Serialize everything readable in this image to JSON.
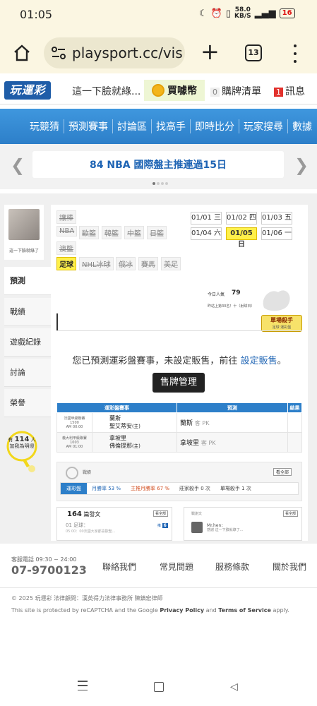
{
  "status_bar": {
    "time": "01:05",
    "net_speed": "58.0",
    "net_unit": "KB/S",
    "battery": "16"
  },
  "browser": {
    "url": "playsport.cc/vis",
    "tab_count": "13"
  },
  "site_header": {
    "logo": "玩運彩",
    "nickname": "這一下臉就綠...",
    "coin_label": "買噱幣",
    "cart_count": "0",
    "cart_label": "購牌清單",
    "msg_count": "1",
    "msg_label": "訊息"
  },
  "nav": {
    "items": [
      "玩競猜",
      "預測賽事",
      "討論區",
      "找高手",
      "即時比分",
      "玩家搜尋",
      "數據"
    ]
  },
  "banner": {
    "text": "84 NBA 國際盤主推連過15日"
  },
  "profile": {
    "nickname": "這一下臉就綠了",
    "fans_prefix": "有",
    "fans_count": "114",
    "fans_suffix": "人",
    "fans_line2": "加我為明燈"
  },
  "side_tabs": [
    "預測",
    "戰績",
    "遊戲紀錄",
    "討論",
    "榮譽"
  ],
  "categories": {
    "row1": [
      "讓棒"
    ],
    "row2": [
      "NBA",
      "歐籃",
      "韓籃",
      "中籃",
      "日籃"
    ],
    "row3": [
      "澳籃"
    ],
    "row4": [
      "足球",
      "NHL冰球",
      "俄冰",
      "賽馬",
      "美足"
    ]
  },
  "dates": [
    "01/01 三",
    "01/02 四",
    "01/03 五",
    "01/04 六",
    "01/05 日",
    "01/06 一"
  ],
  "popularity": {
    "label": "今日人氣",
    "value": "79",
    "rank": "昨站上第30名！十（射球日）"
  },
  "badge": {
    "title": "單場殺手",
    "sub": "足球 運彩盤"
  },
  "notice": {
    "text": "您已預測運彩盤賽事，未設定販售，前往",
    "link": "設定販售",
    "end": "。"
  },
  "sale_button": "售牌管理",
  "prediction_table": {
    "headers": [
      "運彩盤賽事",
      "預測",
      "結果"
    ],
    "rows": [
      {
        "league": "法國甲級聯賽",
        "code": "1500",
        "time": "AM 00:00",
        "home": "蘭斯",
        "away": "聖艾蒂安",
        "away_mark": "(主)",
        "pick": "蘭斯",
        "pick_type": "客 PK"
      },
      {
        "league": "義大利甲級聯賽",
        "code": "1003",
        "time": "AM 01:00",
        "home": "拿坡里",
        "away": "佛倫提那",
        "away_mark": "(主)",
        "pick": "拿坡里",
        "pick_type": "客 PK"
      }
    ]
  },
  "record": {
    "title": "戰績",
    "view_all": "看全部",
    "tab": "運彩盤",
    "month_win": "月勝率 53 %",
    "main_win": "主推月勝率 67 %",
    "season_kill": "莊家殺手 0 次",
    "single_kill": "單場殺手 1 次"
  },
  "articles": {
    "count": "164",
    "label": "篇發文",
    "view_all": "看全部",
    "line1": "01 足球：",
    "line2": "05  00：00法國大家都喜歡聖...",
    "tag": "推",
    "tag_num": "6"
  },
  "messages": {
    "title": "戰謝文",
    "view_all": "看全部",
    "name": "Mr.hen：",
    "text": "感謝 這一下臉就綠了..."
  },
  "footer": {
    "tel_label": "客服電話 09:30 ~ 24:00",
    "tel": "07-9700123",
    "links": [
      "聯絡我們",
      "常見問題",
      "服務條款",
      "關於我們"
    ],
    "copyright": "© 2025 玩運彩 法律顧問：漢英得力法律事務所 陳鎮宏律師",
    "recaptcha_pre": "This site is protected by reCAPTCHA and the Google",
    "privacy": "Privacy Policy",
    "and": "and",
    "terms": "Terms of Service",
    "apply": "apply."
  },
  "colors": {
    "brand_blue": "#2d7fc9",
    "highlight": "#fff04a",
    "browser_bg": "#fbf6e2"
  }
}
